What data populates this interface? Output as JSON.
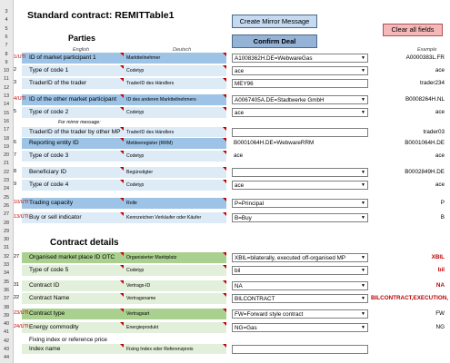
{
  "title": "Standard contract: REMITTable1",
  "buttons": {
    "mirror": "Create Mirror Message",
    "confirm": "Confirm Deal",
    "clear": "Clear all fields"
  },
  "sections": {
    "parties": "Parties",
    "contract": "Contract details"
  },
  "col_headers": {
    "english": "English",
    "deutsch": "Deutsch",
    "example": "Example"
  },
  "row_numbers": [
    "3",
    "4",
    "5",
    "6",
    "7",
    "8",
    "9",
    "10",
    "11",
    "12",
    "13",
    "14",
    "15",
    "16",
    "17",
    "18",
    "19",
    "20",
    "21",
    "22",
    "23",
    "24",
    "25",
    "26",
    "27",
    "28",
    "29",
    "30",
    "31",
    "32",
    "33",
    "34",
    "35",
    "36",
    "37",
    "38",
    "39",
    "40",
    "41",
    "42",
    "43",
    "44"
  ],
  "rows": [
    {
      "num": "1/UTI",
      "label": "ID of market participant 1",
      "de": "Marktteilnehmer",
      "value": "A1008362H.DE=WebwareGas",
      "example": "A0000383L.FR",
      "dropdown": true
    },
    {
      "num": "2",
      "label": "Type of code 1",
      "de": "Codetyp",
      "value": "ace",
      "example": "ace",
      "dropdown": true
    },
    {
      "num": "3",
      "label": "TraderID of the trader",
      "de": "TraderID des Händlers",
      "value": "MEY96",
      "example": "trader234",
      "dropdown": false
    },
    {
      "num": "4/UTI",
      "label": "ID of the other market participant",
      "de": "ID des anderen Marktteilnehmers",
      "value": "A0067405A.DE=Stadtwerke GmbH",
      "example": "B0008264H.NL",
      "dropdown": true
    },
    {
      "num": "5",
      "label": "Type of code 2",
      "de": "Codetyp",
      "value": "ace",
      "example": "ace",
      "dropdown": true
    },
    {
      "num": "",
      "note": "For mirror message:",
      "label": "TraderID of the trader by other MP",
      "de": "TraderID des Händlers",
      "value": "",
      "example": "trader03",
      "dropdown": false
    },
    {
      "num": "6",
      "label": "Reporting entity ID",
      "de": "Meldeeregister (RRM)",
      "value": "B0001064H.DE=WebwareRRM",
      "example": "B0001064H.DE",
      "dropdown": false
    },
    {
      "num": "7",
      "label": "Type of code 3",
      "de": "Codetyp",
      "value": "ace",
      "example": "ace",
      "dropdown": false
    },
    {
      "num": "8",
      "label": "Beneficiary ID",
      "de": "Begünstigter",
      "value": "",
      "example": "B0002849H.DE",
      "dropdown": true
    },
    {
      "num": "9",
      "label": "Type of code 4",
      "de": "Codetyp",
      "value": "ace",
      "example": "ace",
      "dropdown": true
    },
    {
      "num": "10/UTI",
      "label": "Trading capacity",
      "de": "Rolle",
      "value": "P=Principal",
      "example": "P",
      "dropdown": true
    },
    {
      "num": "13/UTI",
      "label": "Buy or sell indicator",
      "de": "Kennzeichen Verkäufer oder Käufer",
      "value": "B=Buy",
      "example": "B",
      "dropdown": true
    },
    {
      "num": "27",
      "label": "Organised market place ID OTC",
      "de": "Organisierter Marktplatz",
      "value": "XBIL=bilaterally, executed off-organised MP",
      "example": "XBIL",
      "dropdown": true
    },
    {
      "num": "",
      "label": "Type of code 5",
      "de": "Codetyp",
      "value": "bil",
      "example": "bil",
      "dropdown": true
    },
    {
      "num": "31",
      "label": "Contract ID",
      "de": "Vertrags-ID",
      "value": "NA",
      "example": "NA",
      "dropdown": true
    },
    {
      "num": "22",
      "label": "Contract Name",
      "de": "Vertragsname",
      "value": "BILCONTRACT",
      "example": "BILCONTRACT,EXECUTION, D",
      "dropdown": true
    },
    {
      "num": "23/UTI",
      "label": "Contract type",
      "de": "Vertragsart",
      "value": "FW=Forward style contract",
      "example": "FW",
      "dropdown": true
    },
    {
      "num": "24/UTI",
      "label": "Energy commodity",
      "de": "Energieprodukt",
      "value": "NG=Gas",
      "example": "NG",
      "dropdown": true
    },
    {
      "num": "",
      "note": "Fixing index or reference price",
      "label": "Index name",
      "de": "Fixing Index oder Referenzpreis",
      "value": "",
      "example": "",
      "dropdown": false
    }
  ]
}
